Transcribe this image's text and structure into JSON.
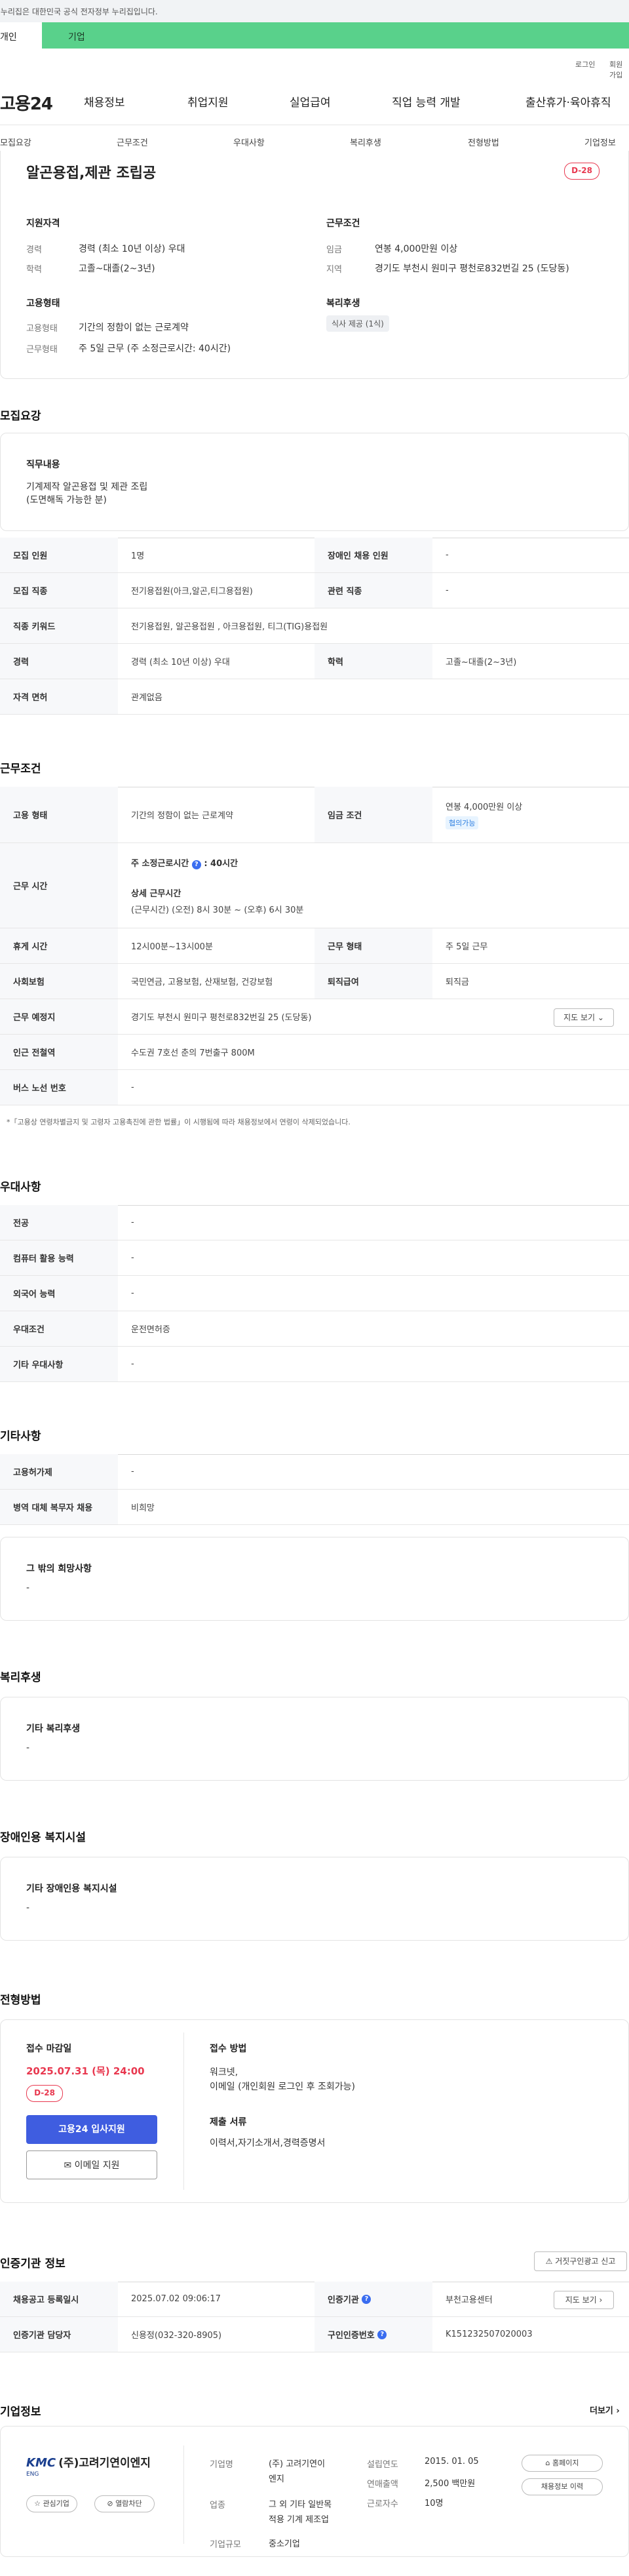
{
  "top": {
    "gov_notice": "이 누리집은 대한민국 공식 전자정부 누리집입니다.",
    "tabs": [
      "개인",
      "기업"
    ],
    "util_links": [
      "로그인",
      "회원가입"
    ],
    "logo": "고용24",
    "gnb": [
      "채용정보",
      "취업지원",
      "실업급여",
      "직업 능력 개발",
      "출산휴가·육아휴직"
    ],
    "subnav": [
      "모집요강",
      "근무조건",
      "우대사항",
      "복리후생",
      "전형방법",
      "기업정보"
    ]
  },
  "summary": {
    "title": "알곤용접,제관 조립공",
    "dday": "D-28",
    "qual_head": "지원자격",
    "qual": [
      {
        "label": "경력",
        "value": "경력 (최소 10년 이상) 우대"
      },
      {
        "label": "학력",
        "value": "고졸~대졸(2~3년)"
      }
    ],
    "emp_head": "고용형태",
    "emp": [
      {
        "label": "고용형태",
        "value": "기간의 정함이 없는 근로계약"
      },
      {
        "label": "근무형태",
        "value": "주 5일 근무 (주 소정근로시간: 40시간)"
      }
    ],
    "cond_head": "근무조건",
    "cond": [
      {
        "label": "임금",
        "value": "연봉 4,000만원 이상"
      },
      {
        "label": "지역",
        "value": "경기도 부천시 원미구 평천로832번길 25 (도당동)"
      }
    ],
    "welfare_head": "복리후생",
    "welfare_chip": "식사 제공 (1식)"
  },
  "recruit": {
    "section_title": "모집요강",
    "duty_head": "직무내용",
    "duty_text_1": "기계제작 알곤용접 및 제관 조립",
    "duty_text_2": "(도면해독 가능한 분)",
    "rows": [
      {
        "th": "모집 인원",
        "td": "1명",
        "th2": "장애인 채용 인원",
        "td2": "-"
      },
      {
        "th": "모집 직종",
        "td": "전기용접원(아크,알곤,티그용접원)",
        "th2": "관련 직종",
        "td2": "-"
      },
      {
        "th": "직종 키워드",
        "td": "전기용접원, 알곤용접원 , 아크용접원, 티그(TIG)용접원"
      },
      {
        "th": "경력",
        "td": "경력 (최소 10년 이상) 우대",
        "th2": "학력",
        "td2": "고졸~대졸(2~3년)"
      },
      {
        "th": "자격 면허",
        "td": "관계없음"
      }
    ]
  },
  "work": {
    "section_title": "근무조건",
    "employment_type_th": "고용 형태",
    "employment_type": "기간의 정함이 없는 근로계약",
    "wage_th": "임금 조건",
    "wage": "연봉 4,000만원 이상",
    "wage_chip": "협의가능",
    "hours_th": "근무 시간",
    "hours_1_prefix": "주 소정근로시간",
    "hours_1_value": ": 40시간",
    "hours_2_head": "상세 근무시간",
    "hours_2": "(근무시간) (오전) 8시 30분 ~ (오후) 6시 30분",
    "rest_th": "휴게 시간",
    "rest": "12시00분~13시00분",
    "worktype_th": "근무 형태",
    "worktype": "주 5일 근무",
    "insurance_th": "사회보험",
    "insurance": "국민연금, 고용보험, 산재보험, 건강보험",
    "severance_th": "퇴직급여",
    "severance": "퇴직금",
    "place_th": "근무 예정지",
    "place": "경기도 부천시 원미구 평천로832번길 25 (도당동)",
    "map_btn": "지도 보기",
    "station_th": "인근 전철역",
    "station": "수도권 7호선 춘의 7번출구 800M",
    "bus_th": "버스 노선 번호",
    "bus": "-",
    "note": "*「고용상 연령차별금지 및 고령자 고용촉진에 관한 법률」이 시행됨에 따라 채용정보에서 연령이 삭제되었습니다."
  },
  "pref": {
    "section_title": "우대사항",
    "rows": [
      {
        "th": "전공",
        "td": "-"
      },
      {
        "th": "컴퓨터 활용 능력",
        "td": "-"
      },
      {
        "th": "외국어 능력",
        "td": "-"
      },
      {
        "th": "우대조건",
        "td": "운전면허증"
      },
      {
        "th": "기타 우대사항",
        "td": "-"
      }
    ]
  },
  "etc": {
    "section_title": "기타사항",
    "rows": [
      {
        "th": "고용허가제",
        "td": "-"
      },
      {
        "th": "병역 대체 복무자 채용",
        "td": "비희망"
      }
    ],
    "other_head": "그 밖의 희망사항",
    "other_val": "-"
  },
  "welfare": {
    "section_title": "복리후생",
    "head": "기타 복리후생",
    "val": "-"
  },
  "disabled": {
    "section_title": "장애인용 복지시설",
    "head": "기타 장애인용 복지시설",
    "val": "-"
  },
  "process": {
    "section_title": "전형방법",
    "deadline_head": "접수 마감일",
    "deadline": "2025.07.31 (목) 24:00",
    "dday": "D-28",
    "apply_btn": "고용24 입사지원",
    "email_btn": "이메일 지원",
    "method_head": "접수 방법",
    "method_1": "워크넷,",
    "method_2": "이메일 (개인회원 로그인 후 조회가능)",
    "docs_head": "제출 서류",
    "docs": "이력서,자기소개서,경력증명서"
  },
  "certify": {
    "section_title": "인증기관 정보",
    "report_btn": "거짓구인광고 신고",
    "rows": [
      {
        "th": "채용공고 등록일시",
        "td": "2025.07.02 09:06:17",
        "th2": "인증기관",
        "td2": "부천고용센터"
      },
      {
        "th": "인증기관 담당자",
        "td": "신용정(032-320-8905)",
        "th2": "구인인증번호",
        "td2": "K151232507020003"
      }
    ],
    "map_btn": "지도 보기"
  },
  "company": {
    "section_title": "기업정보",
    "more": "더보기",
    "logo_kr": "(주)고려기연이엔지",
    "logo_en": "KMC",
    "logo_sub": "ENG",
    "interest_btn": "관심기업",
    "block_btn": "열람차단",
    "name_label": "기업명",
    "name_value_1": "(주) 고려기연이",
    "name_value_2": "엔지",
    "biz_label": "업종",
    "biz_value_1": "그 외 기타 일반목",
    "biz_value_2": "적용 기계 제조업",
    "scale_label": "기업규모",
    "scale_value": "중소기업",
    "est_label": "설립연도",
    "est_value": "2015. 01. 05",
    "sales_label": "연매출액",
    "sales_value": "2,500 백만원",
    "emp_label": "근로자수",
    "emp_value": "10명",
    "home_btn": "홈페이지",
    "history_btn": "채용정보 이력"
  }
}
